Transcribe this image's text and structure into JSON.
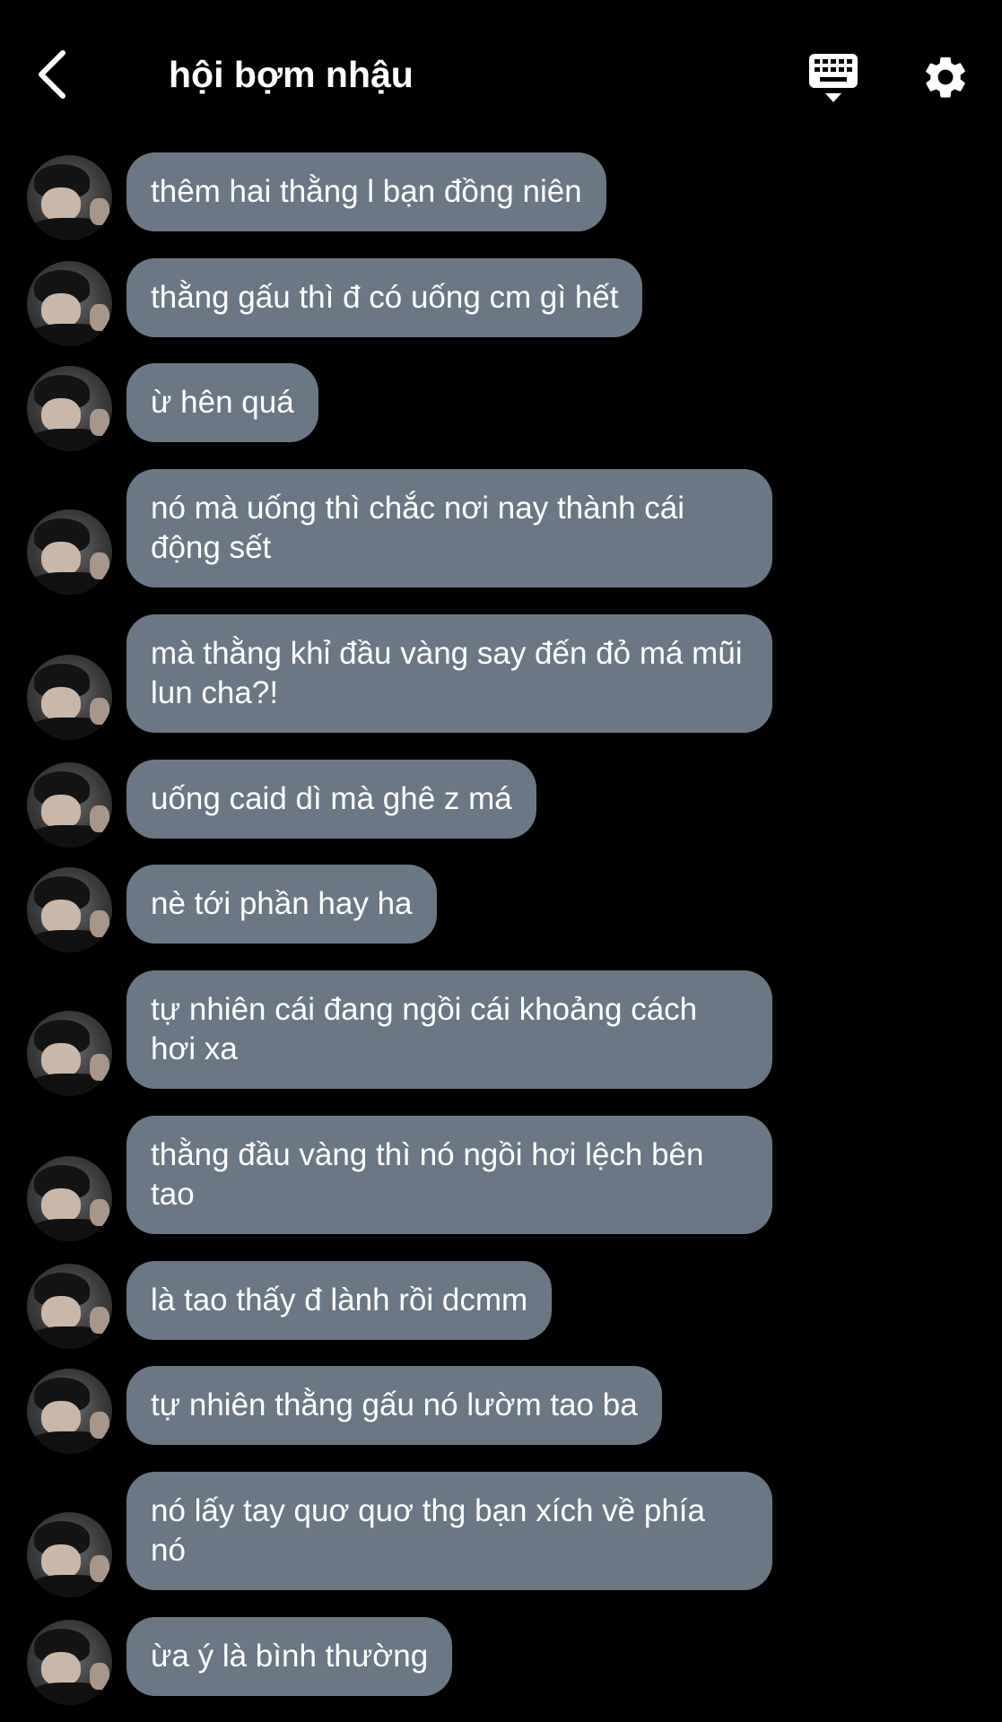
{
  "header": {
    "title": "hội bợm nhậu",
    "back_icon": "chevron-left-icon",
    "keyboard_icon": "keyboard-icon",
    "settings_icon": "gear-icon"
  },
  "colors": {
    "background": "#000000",
    "bubble": "#6b7785",
    "text": "#ffffff"
  },
  "messages": [
    {
      "text": "thêm hai thằng l bạn đồng niên"
    },
    {
      "text": "thằng gấu thì đ có uống cm gì hết"
    },
    {
      "text": "ừ hên quá"
    },
    {
      "text": "nó mà uống thì chắc nơi nay thành cái động sết"
    },
    {
      "text": "mà thằng khỉ đầu vàng say đến đỏ má mũi lun cha?!"
    },
    {
      "text": "uống caid dì mà ghê z má"
    },
    {
      "text": "nè tới phần hay ha"
    },
    {
      "text": "tự nhiên cái đang ngồi cái khoảng cách hơi xa"
    },
    {
      "text": "thằng đầu vàng thì nó ngồi hơi lệch bên tao"
    },
    {
      "text": "là tao thấy đ lành rồi dcmm"
    },
    {
      "text": "tự nhiên thằng gấu nó lườm tao ba"
    },
    {
      "text": "nó lấy tay quơ quơ thg bạn xích về phía nó"
    },
    {
      "text": "ừa ý là bình thường"
    }
  ]
}
